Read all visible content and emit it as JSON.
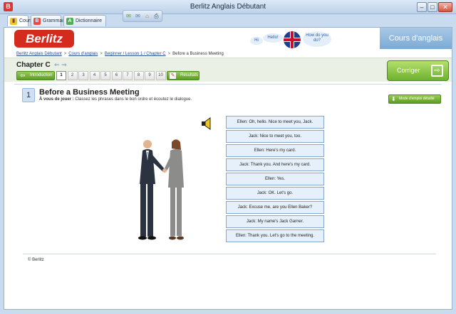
{
  "window": {
    "title": "Berlitz Anglais Débutant"
  },
  "tabs": [
    {
      "label": "Cours",
      "icon": "book-icon",
      "active": true
    },
    {
      "label": "Grammaire",
      "icon": "grammar-book-icon",
      "active": false
    },
    {
      "label": "Dictionnaire audio",
      "icon": "dictionary-icon",
      "active": false
    }
  ],
  "header": {
    "logo": "Berlitz",
    "banner_words": [
      "Hi",
      "Hello!",
      "How do you do?"
    ],
    "course_label": "Cours d'anglais"
  },
  "breadcrumb": {
    "items": [
      "Berlitz Anglais Débutant",
      "Cours d'anglais",
      "Beginner / Lesson 1 / Chapter C"
    ],
    "current": "Before a Business Meeting",
    "separator": ">"
  },
  "chapter": {
    "title": "Chapter C",
    "intro_label": "Introduction",
    "numbers": [
      "1",
      "2",
      "3",
      "4",
      "5",
      "6",
      "7",
      "8",
      "9",
      "10"
    ],
    "active_number": "1",
    "results_label": "Résultats",
    "correct_label": "Corriger"
  },
  "exercise": {
    "number": "1",
    "title": "Before a Business Meeting",
    "instruction_prefix": "À vous de jouer :",
    "instruction_text": "Classez les phrases dans le bon ordre et écoutez le dialogue.",
    "mode_label": "Mode d'emploi détaillé",
    "sentences": [
      "Ellen: Oh, hello. Nice to meet you, Jack.",
      "Jack: Nice to meet you, too.",
      "Ellen: Here's my card.",
      "Jack: Thank you. And here's my card.",
      "Ellen: Yes.",
      "Jack: OK. Let's go.",
      "Jack: Excuse me, are you Ellen Baker?",
      "Jack: My name's Jack Garner.",
      "Ellen: Thank you. Let's go to the meeting."
    ]
  },
  "footer": {
    "copyright": "© Berlitz"
  },
  "colors": {
    "accent_green": "#6eb12f",
    "brand_red": "#d52b1e",
    "sentence_bg": "#e6f0fa"
  }
}
